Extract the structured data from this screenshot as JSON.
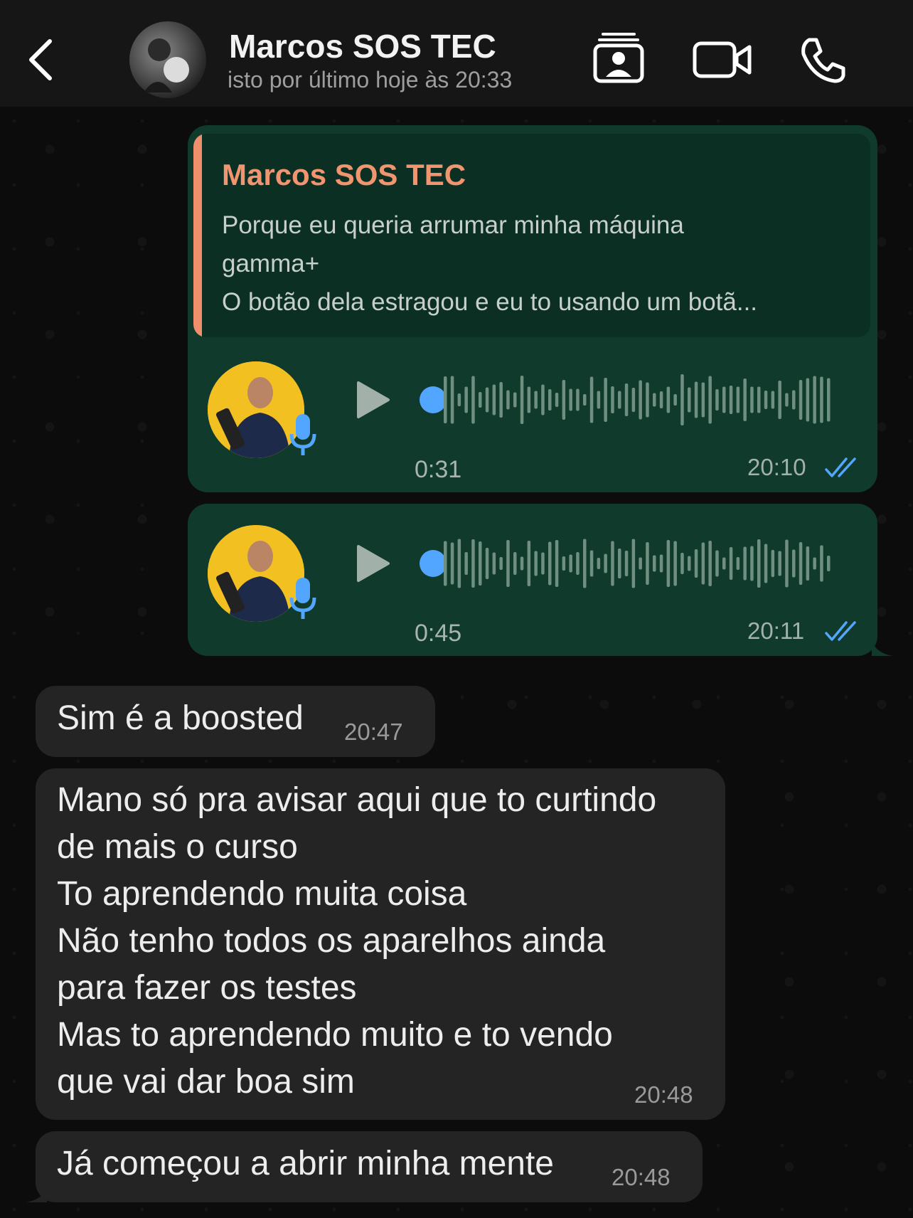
{
  "header": {
    "contact_name": "Marcos SOS TEC",
    "status": "isto por último hoje às 20:33",
    "icons": [
      "back-chevron-icon",
      "contact-card-icon",
      "video-call-icon",
      "phone-call-icon"
    ]
  },
  "colors": {
    "outgoing_bubble": "#103a2c",
    "incoming_bubble": "#242424",
    "quote_accent": "#ef8f6c",
    "read_ticks": "#53a6ff"
  },
  "messages": [
    {
      "direction": "out",
      "reply": {
        "author": "Marcos SOS TEC",
        "lines": [
          "Porque eu queria arrumar minha máquina",
          "gamma+",
          "O botão dela estragou e eu to usando um botã..."
        ]
      },
      "voice": {
        "duration": "0:31",
        "time": "20:10",
        "status": "read",
        "progress": 0
      }
    },
    {
      "direction": "out",
      "voice": {
        "duration": "0:45",
        "time": "20:11",
        "status": "read",
        "progress": 0
      }
    },
    {
      "direction": "in",
      "lines": [
        "Sim é a boosted"
      ],
      "time": "20:47"
    },
    {
      "direction": "in",
      "lines": [
        "Mano só pra avisar aqui que to curtindo",
        "de mais o curso",
        "To aprendendo muita coisa",
        "Não tenho todos os aparelhos ainda",
        "para fazer os testes",
        "Mas to aprendendo muito e to vendo",
        "que vai dar boa sim"
      ],
      "time": "20:48"
    },
    {
      "direction": "in",
      "lines": [
        "Já começou a abrir minha mente"
      ],
      "time": "20:48"
    }
  ]
}
